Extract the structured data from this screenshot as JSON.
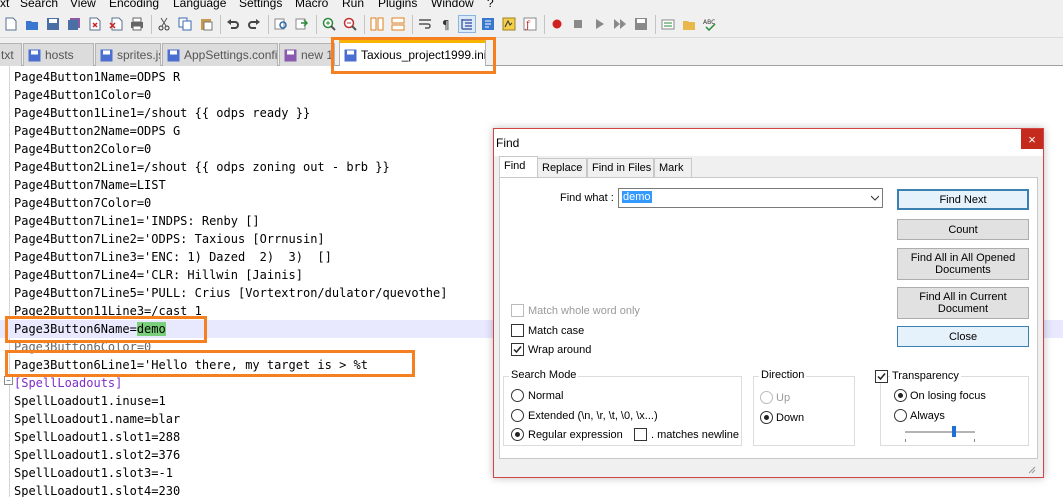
{
  "menu": [
    "xt",
    "Search",
    "View",
    "Encoding",
    "Language",
    "Settings",
    "Macro",
    "Run",
    "Plugins",
    "Window",
    "?"
  ],
  "tabs": [
    {
      "label": "txt",
      "active": false
    },
    {
      "label": "hosts",
      "active": false
    },
    {
      "label": "sprites.json",
      "active": false
    },
    {
      "label": "AppSettings.config",
      "active": false
    },
    {
      "label": "new 1",
      "active": false
    },
    {
      "label": "Taxious_project1999.ini",
      "active": true
    }
  ],
  "editor": {
    "lines": [
      "Page4Button1Name=ODPS R",
      "Page4Button1Color=0",
      "Page4Button1Line1=/shout {{ odps ready }}",
      "Page4Button2Name=ODPS G",
      "Page4Button2Color=0",
      "Page4Button2Line1=/shout {{ odps zoning out - brb }}",
      "Page4Button7Name=LIST",
      "Page4Button7Color=0",
      "Page4Button7Line1='INDPS: Renby []",
      "Page4Button7Line2='ODPS: Taxious [Orrnusin]",
      "Page4Button7Line3='ENC: 1) Dazed  2)  3)  []",
      "Page4Button7Line4='CLR: Hillwin [Jainis]",
      "Page4Button7Line5='PULL: Crius [Vortextron/dulator/quevothe]",
      "Page2Button11Line3=/cast 1",
      "Page3Button6Name=",
      "Page3Button6Color=0",
      "Page3Button6Line1='Hello there, my target is > %t",
      "[SpellLoadouts]",
      "SpellLoadout1.inuse=1",
      "SpellLoadout1.name=blar",
      "SpellLoadout1.slot1=288",
      "SpellLoadout1.slot2=376",
      "SpellLoadout1.slot3=-1",
      "SpellLoadout1.slot4=230"
    ],
    "highlight": "demo"
  },
  "find_dialog": {
    "title": "Find",
    "close_glyph": "×",
    "tabs": [
      "Find",
      "Replace",
      "Find in Files",
      "Mark"
    ],
    "find_what_label": "Find what :",
    "find_what_value": "demo",
    "buttons": {
      "find_next": "Find Next",
      "count": "Count",
      "find_all_opened_1": "Find All in All Opened",
      "find_all_opened_2": "Documents",
      "find_all_current_1": "Find All in Current",
      "find_all_current_2": "Document",
      "close": "Close"
    },
    "options": {
      "match_whole_word": "Match whole word only",
      "match_case": "Match case",
      "wrap_around": "Wrap around",
      "match_whole_word_checked": false,
      "match_case_checked": false,
      "wrap_around_checked": true
    },
    "search_mode": {
      "title": "Search Mode",
      "normal": "Normal",
      "extended": "Extended (\\n, \\r, \\t, \\0, \\x...)",
      "regex": "Regular expression",
      "matches_newline": ". matches newline",
      "selected": "regex"
    },
    "direction": {
      "title": "Direction",
      "up": "Up",
      "down": "Down",
      "selected": "down"
    },
    "transparency": {
      "title": "Transparency",
      "checked": true,
      "on_losing_focus": "On losing focus",
      "always": "Always",
      "selected": "on_losing_focus",
      "level": 0.7
    }
  },
  "colors": {
    "annotation": "#f4801f",
    "match_highlight": "#7ad07a",
    "current_line": "#e8e8ff",
    "section_text": "#7f2ec8"
  }
}
